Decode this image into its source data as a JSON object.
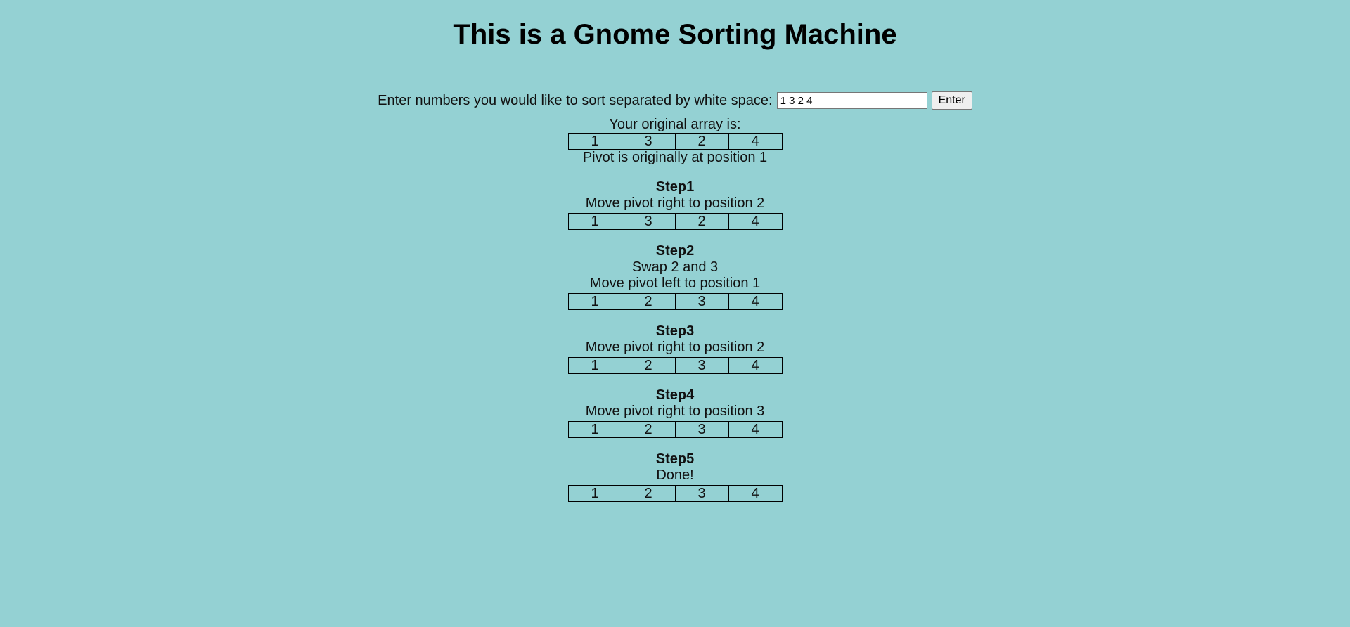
{
  "page": {
    "title": "This is a Gnome Sorting Machine"
  },
  "form": {
    "prompt": "Enter numbers you would like to sort separated by white space:",
    "input_value": "1 3 2 4",
    "submit_label": "Enter"
  },
  "original": {
    "label": "Your original array is:",
    "array": [
      "1",
      "3",
      "2",
      "4"
    ],
    "pivot_note": "Pivot is originally at position 1"
  },
  "steps": [
    {
      "title": "Step1",
      "actions": [
        "Move pivot right to position 2"
      ],
      "array": [
        "1",
        "3",
        "2",
        "4"
      ]
    },
    {
      "title": "Step2",
      "actions": [
        "Swap 2 and 3",
        "Move pivot left to position 1"
      ],
      "array": [
        "1",
        "2",
        "3",
        "4"
      ]
    },
    {
      "title": "Step3",
      "actions": [
        "Move pivot right to position 2"
      ],
      "array": [
        "1",
        "2",
        "3",
        "4"
      ]
    },
    {
      "title": "Step4",
      "actions": [
        "Move pivot right to position 3"
      ],
      "array": [
        "1",
        "2",
        "3",
        "4"
      ]
    },
    {
      "title": "Step5",
      "actions": [
        "Done!"
      ],
      "array": [
        "1",
        "2",
        "3",
        "4"
      ]
    }
  ]
}
